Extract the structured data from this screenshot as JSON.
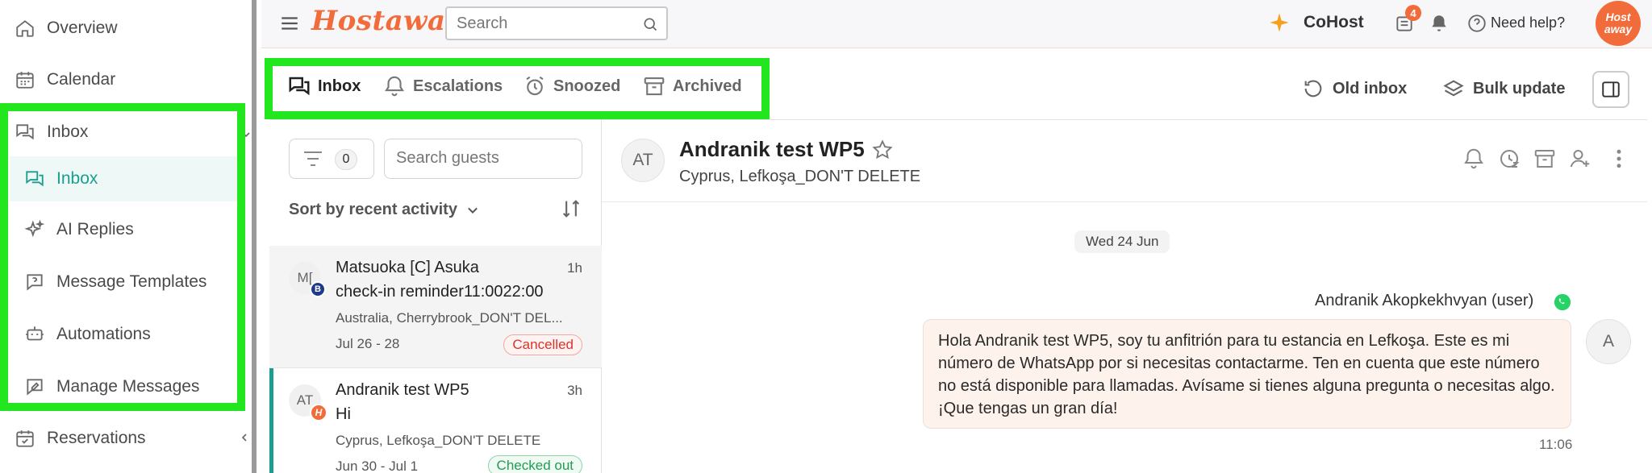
{
  "sidebar": {
    "overview": "Overview",
    "calendar": "Calendar",
    "inbox_group": "Inbox",
    "inbox_sub": [
      "Inbox",
      "AI Replies",
      "Message Templates",
      "Automations",
      "Manage Messages"
    ],
    "reservations": "Reservations"
  },
  "topbar": {
    "brand": "Hostaway",
    "search_placeholder": "Search",
    "cohost": "CoHost",
    "notif_count": "4",
    "need_help": "Need help?",
    "avatar_text": "Host away"
  },
  "inbox_tabs": [
    "Inbox",
    "Escalations",
    "Snoozed",
    "Archived"
  ],
  "header_actions": {
    "old_inbox": "Old inbox",
    "bulk_update": "Bulk update"
  },
  "filters": {
    "filter_count": "0",
    "search_guests_placeholder": "Search guests",
    "sort_label": "Sort by recent activity"
  },
  "conversations": [
    {
      "initials": "M[",
      "channel": "B",
      "name": "Matsuoka [C] Asuka",
      "time": "1h",
      "preview": "check-in reminder11:0022:00",
      "location": "Australia, Cherrybrook_DON'T DEL...",
      "dates": "Jul 26 - 28",
      "status": "Cancelled"
    },
    {
      "initials": "AT",
      "channel": "H",
      "name": "Andranik test WP5",
      "time": "3h",
      "preview": "Hi",
      "location": "Cyprus, Lefkoşa_DON'T DELETE",
      "dates": "Jun 30 - Jul 1",
      "status": "Checked out"
    }
  ],
  "chat": {
    "initials": "AT",
    "guest_name": "Andranik test WP5",
    "location": "Cyprus, Lefkoşa_DON'T DELETE",
    "date_divider": "Wed 24 Jun",
    "sender": "Andranik Akopkekhvyan (user)",
    "message": "Hola Andranik test WP5, soy tu anfitrión para tu estancia en Lefkoşa. Este es mi número de WhatsApp por si necesitas contactarme. Ten en cuenta que este número no está disponible para llamadas. Avísame si tienes alguna pregunta o necesitas algo. ¡Que tengas un gran día!",
    "time": "11:06",
    "sender_avatar": "A"
  },
  "colors": {
    "accent": "#1a9e8f",
    "brand": "#f26b3a",
    "highlight": "#22e61e",
    "cancelled": "#d9342b",
    "checked_out": "#1f9d55"
  }
}
